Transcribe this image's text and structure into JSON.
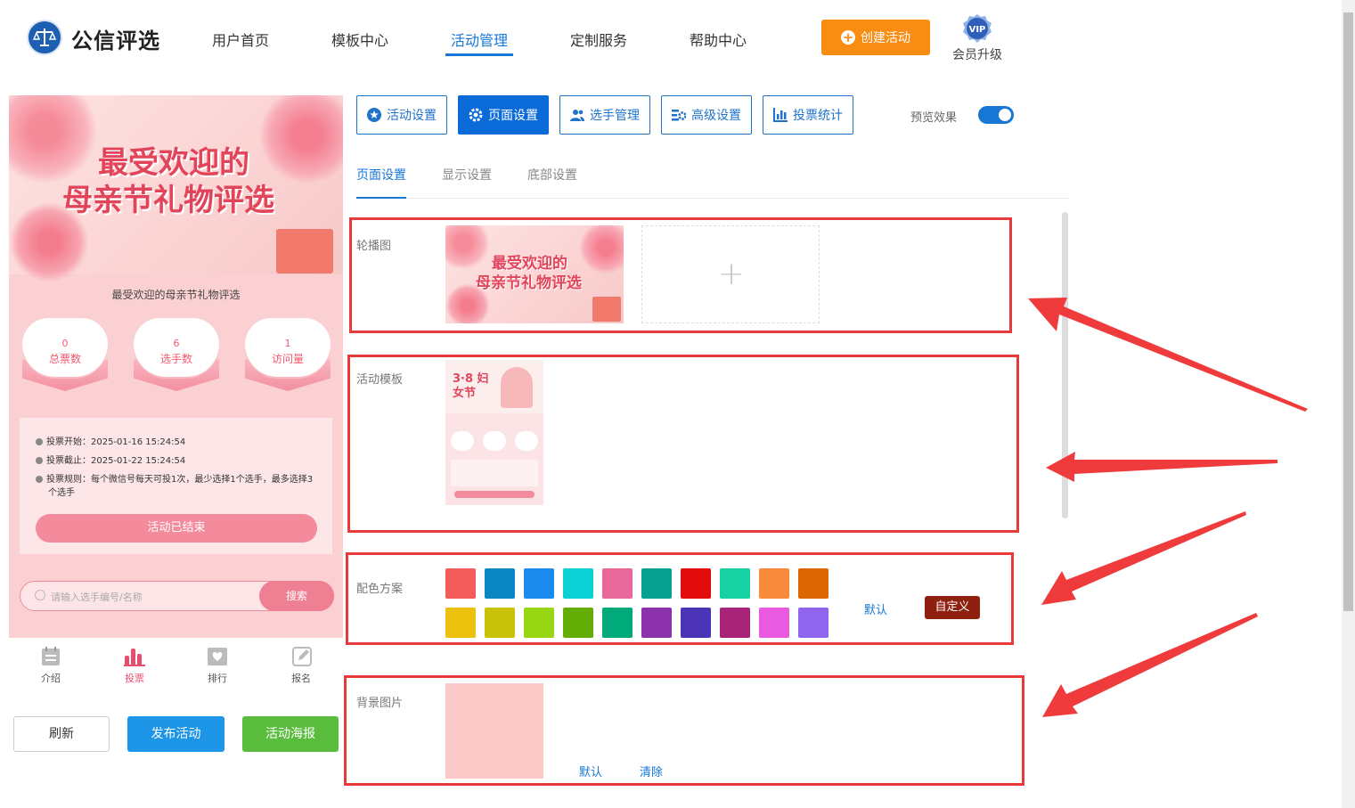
{
  "header": {
    "brand": "公信评选",
    "nav": [
      "用户首页",
      "模板中心",
      "活动管理",
      "定制服务",
      "帮助中心"
    ],
    "active_nav": "活动管理",
    "create_button": "创建活动",
    "vip_badge": "VIP",
    "vip_label": "会员升级"
  },
  "preview": {
    "banner_title_line1": "最受欢迎的",
    "banner_title_line2": "母亲节礼物评选",
    "title": "最受欢迎的母亲节礼物评选",
    "stats": [
      {
        "value": "0",
        "label": "总票数"
      },
      {
        "value": "6",
        "label": "选手数"
      },
      {
        "value": "1",
        "label": "访问量"
      }
    ],
    "info": {
      "start": "投票开始：2025-01-16 15:24:54",
      "end": "投票截止：2025-01-22 15:24:54",
      "rule_line1": "投票规则：每个微信号每天可投1次，最少选择1个选手，最多选择3",
      "rule_line2": "个选手"
    },
    "ended_button": "活动已结束",
    "search_placeholder": "请输入选手编号/名称",
    "search_button": "搜索",
    "tabs": [
      "介绍",
      "投票",
      "排行",
      "报名"
    ],
    "active_tab": "投票"
  },
  "actions": {
    "refresh": "刷新",
    "publish": "发布活动",
    "poster": "活动海报"
  },
  "toolbar": {
    "buttons": [
      "活动设置",
      "页面设置",
      "选手管理",
      "高级设置",
      "投票统计"
    ],
    "active": "页面设置",
    "preview_label": "预览效果",
    "preview_on": true
  },
  "subtabs": {
    "items": [
      "页面设置",
      "显示设置",
      "底部设置"
    ],
    "active": "页面设置"
  },
  "sections": {
    "carousel": {
      "label": "轮播图",
      "thumb_line1": "最受欢迎的",
      "thumb_line2": "母亲节礼物评选"
    },
    "template": {
      "label": "活动模板",
      "thumb_title": "3·8 妇女节"
    },
    "colors": {
      "label": "配色方案",
      "row1": [
        "#f45b5b",
        "#0a86c2",
        "#1a8bec",
        "#0bd1d4",
        "#e8689a",
        "#07a191",
        "#e20c0c",
        "#18d1a3",
        "#f98a3c",
        "#dd6703"
      ],
      "row2": [
        "#edc20e",
        "#c8c30a",
        "#97d612",
        "#64ad07",
        "#00ab79",
        "#8b32ab",
        "#4c34b6",
        "#a72479",
        "#e85ae0",
        "#9065ee"
      ],
      "default_link": "默认",
      "custom_button": "自定义"
    },
    "background": {
      "label": "背景图片",
      "default_link": "默认",
      "clear_link": "清除"
    }
  }
}
